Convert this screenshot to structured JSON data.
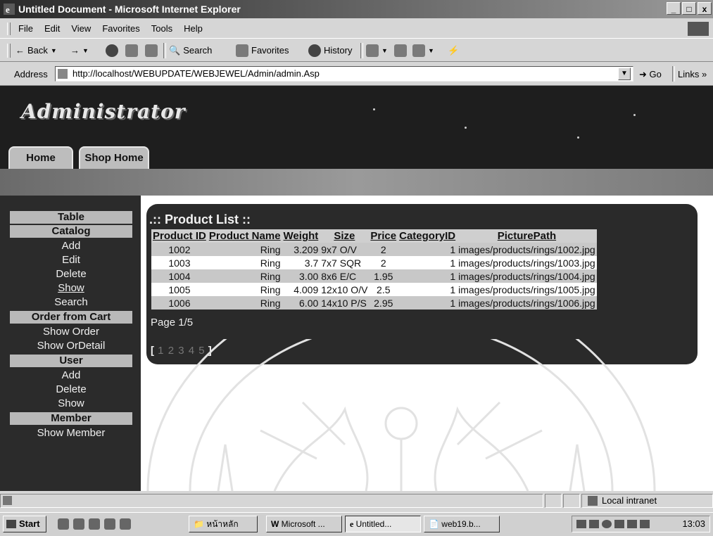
{
  "window": {
    "title": "Untitled Document - Microsoft Internet Explorer",
    "controls": [
      "_",
      "□",
      "x"
    ]
  },
  "menu": {
    "items": [
      "File",
      "Edit",
      "View",
      "Favorites",
      "Tools",
      "Help"
    ]
  },
  "toolbar": {
    "back_label": "Back",
    "search_label": "Search",
    "favorites_label": "Favorites",
    "history_label": "History"
  },
  "address": {
    "label": "Address",
    "url": "http://localhost/WEBUPDATE/WEBJEWEL/Admin/admin.Asp",
    "go_label": "Go",
    "links_label": "Links"
  },
  "site": {
    "brand": "Administrator",
    "tabs": [
      "Home",
      "Shop Home"
    ]
  },
  "sidebar": {
    "sections": [
      {
        "header": "Table",
        "links": []
      },
      {
        "header": "Catalog",
        "links": [
          "Add",
          "Edit",
          "Delete",
          "Show",
          "Search"
        ]
      },
      {
        "header": "Order from Cart",
        "links": [
          "Show Order",
          "Show OrDetail"
        ]
      },
      {
        "header": "User",
        "links": [
          "Add",
          "Delete",
          "Show"
        ]
      },
      {
        "header": "Member",
        "links": [
          "Show Member"
        ]
      }
    ],
    "current": "Show"
  },
  "product_list": {
    "title": ".:: Product List ::",
    "columns": [
      "Product ID",
      "Product Name",
      "Weight",
      "Size",
      "Price",
      "CategoryID",
      "PicturePath"
    ],
    "rows": [
      [
        "1002",
        "Ring",
        "3.209",
        "9x7 O/V",
        "2",
        "1",
        "images/products/rings/1002.jpg"
      ],
      [
        "1003",
        "Ring",
        "3.7",
        "7x7 SQR",
        "2",
        "1",
        "images/products/rings/1003.jpg"
      ],
      [
        "1004",
        "Ring",
        "3.00",
        "8x6 E/C",
        "1.95",
        "1",
        "images/products/rings/1004.jpg"
      ],
      [
        "1005",
        "Ring",
        "4.009",
        "12x10 O/V",
        "2.5",
        "1",
        "images/products/rings/1005.jpg"
      ],
      [
        "1006",
        "Ring",
        "6.00",
        "14x10 P/S",
        "2.95",
        "1",
        "images/products/rings/1006.jpg"
      ]
    ],
    "pager_text": "Page 1/5",
    "page_open": "[",
    "page_links": [
      "1",
      "2",
      "3",
      "4",
      "5"
    ],
    "page_close": "]"
  },
  "status": {
    "zone": "Local intranet"
  },
  "taskbar": {
    "start_label": "Start",
    "tasks": [
      "หน้าหลัก",
      "Microsoft ...",
      "Untitled...",
      "web19.b..."
    ],
    "clock": "13:03"
  }
}
